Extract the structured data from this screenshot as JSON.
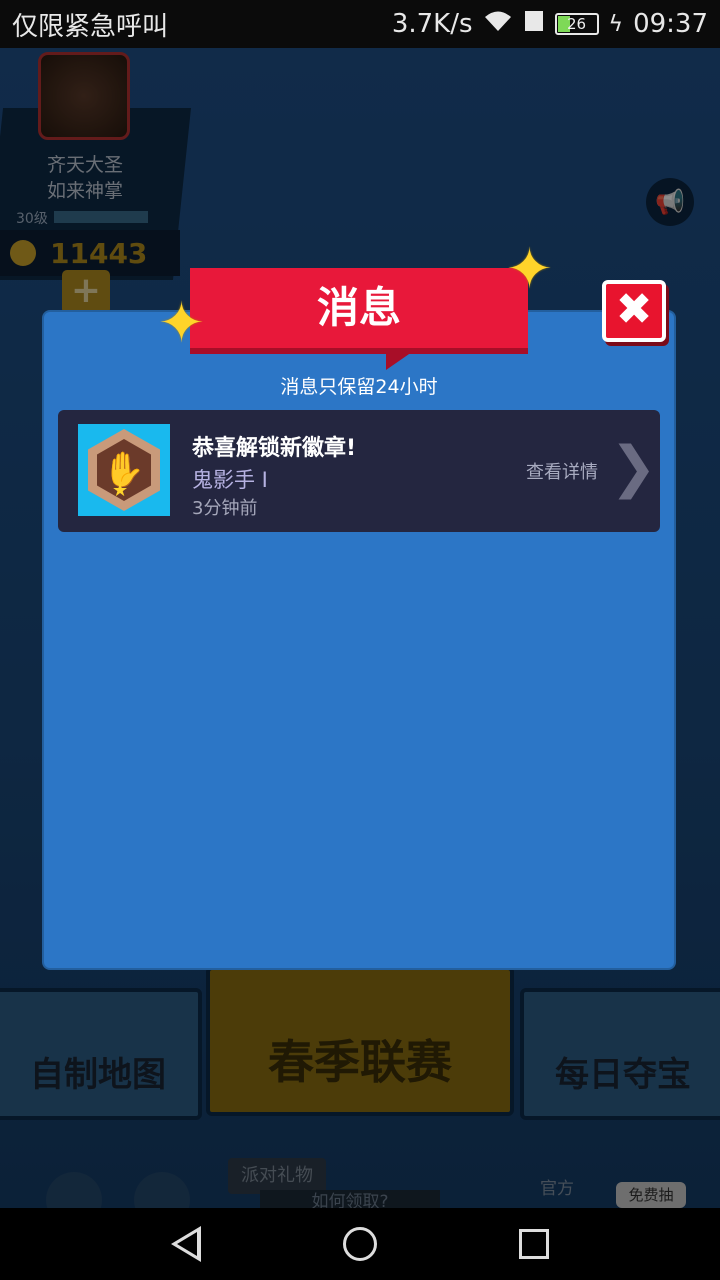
{
  "status_bar": {
    "carrier": "仅限紧急呼叫",
    "speed": "3.7K/s",
    "battery": "26",
    "time": "09:37"
  },
  "background": {
    "profile": {
      "name_line1": "齐天大圣",
      "name_line2": "如来神掌",
      "level": "30级",
      "coins": "11443",
      "plus": "+"
    },
    "cards": {
      "custom_map": "自制地图",
      "spring_league": "春季联赛",
      "daily_treasure": "每日夺宝"
    },
    "party_gift": "派对礼物",
    "how_to_get": "如何领取?",
    "official": "官方",
    "free_draw": "免费抽"
  },
  "modal": {
    "title": "消息",
    "subtitle": "消息只保留24小时",
    "close_glyph": "✖",
    "messages": [
      {
        "title": "恭喜解锁新徽章!",
        "badge_name": "鬼影手 I",
        "time": "3分钟前",
        "detail_label": "查看详情"
      }
    ]
  },
  "icons": {
    "close": "close-icon",
    "badge": "hand-badge-icon",
    "chevron": "chevron-right-icon",
    "wifi": "wifi-icon",
    "megaphone": "megaphone-icon"
  },
  "colors": {
    "modal_bg": "#2c76c6",
    "banner_red": "#e8183a",
    "message_bg": "#242640",
    "badge_bg": "#19b9ee",
    "star_yellow": "#ffd42a"
  }
}
